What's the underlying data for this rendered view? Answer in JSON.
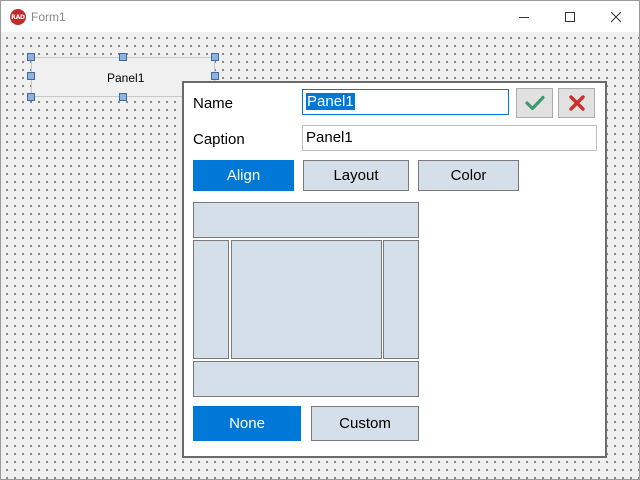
{
  "window": {
    "title": "Form1",
    "icon_text": "RAD",
    "brand_color": "#c22b2b",
    "controls": [
      "minimize-icon",
      "maximize-icon",
      "close-icon"
    ]
  },
  "designer": {
    "panel_caption": "Panel1"
  },
  "editor": {
    "name_label": "Name",
    "name_value": "Panel1",
    "caption_label": "Caption",
    "caption_value": "Panel1",
    "ok_icon": "checkmark-icon",
    "cancel_icon": "x-icon",
    "tabs": [
      {
        "label": "Align",
        "active": true
      },
      {
        "label": "Layout",
        "active": false
      },
      {
        "label": "Color",
        "active": false
      }
    ],
    "align_zones": [
      "top",
      "left",
      "client",
      "right",
      "bottom"
    ],
    "buttons": [
      {
        "label": "None",
        "active": true
      },
      {
        "label": "Custom",
        "active": false
      }
    ]
  },
  "colors": {
    "accent": "#0078d7",
    "zone_fill": "#d5dfe9",
    "ok_green": "#3f9a6e",
    "cancel_red": "#c9302c"
  }
}
